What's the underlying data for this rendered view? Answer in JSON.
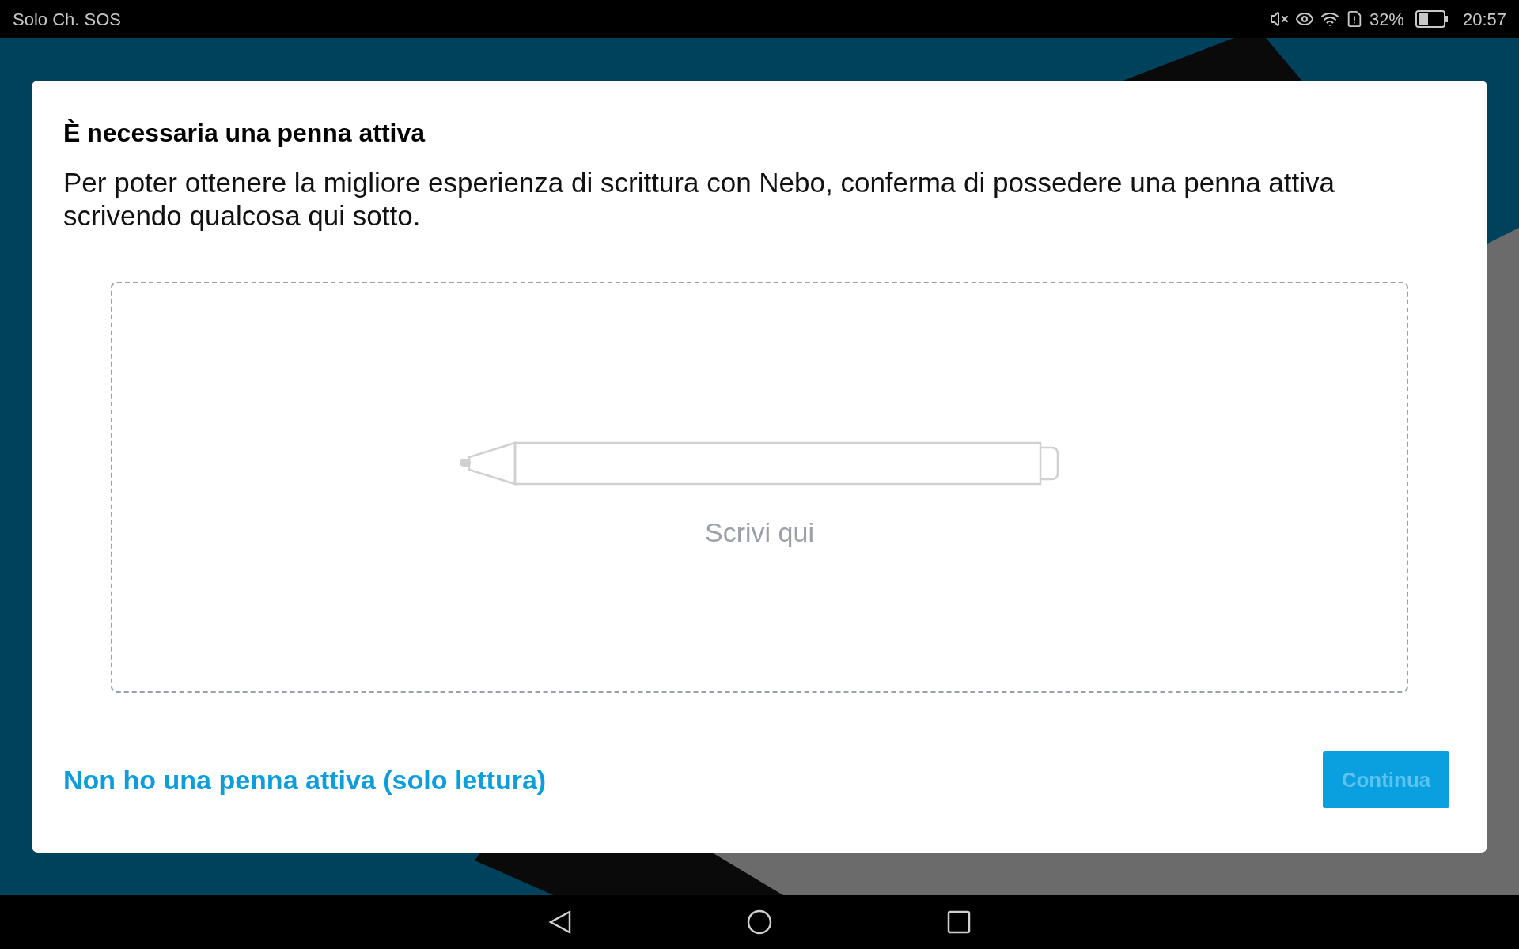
{
  "status_bar": {
    "carrier": "Solo Ch. SOS",
    "battery_percent": "32%",
    "time": "20:57"
  },
  "dialog": {
    "title": "È necessaria una penna attiva",
    "message": "Per poter ottenere la migliore esperienza di scrittura con Nebo, conferma di possedere una penna attiva scrivendo qualcosa qui sotto.",
    "writing_area": {
      "placeholder": "Scrivi qui"
    },
    "link": "Non ho una penna attiva (solo lettura)",
    "button": {
      "label": "Continua",
      "disabled": true
    }
  }
}
